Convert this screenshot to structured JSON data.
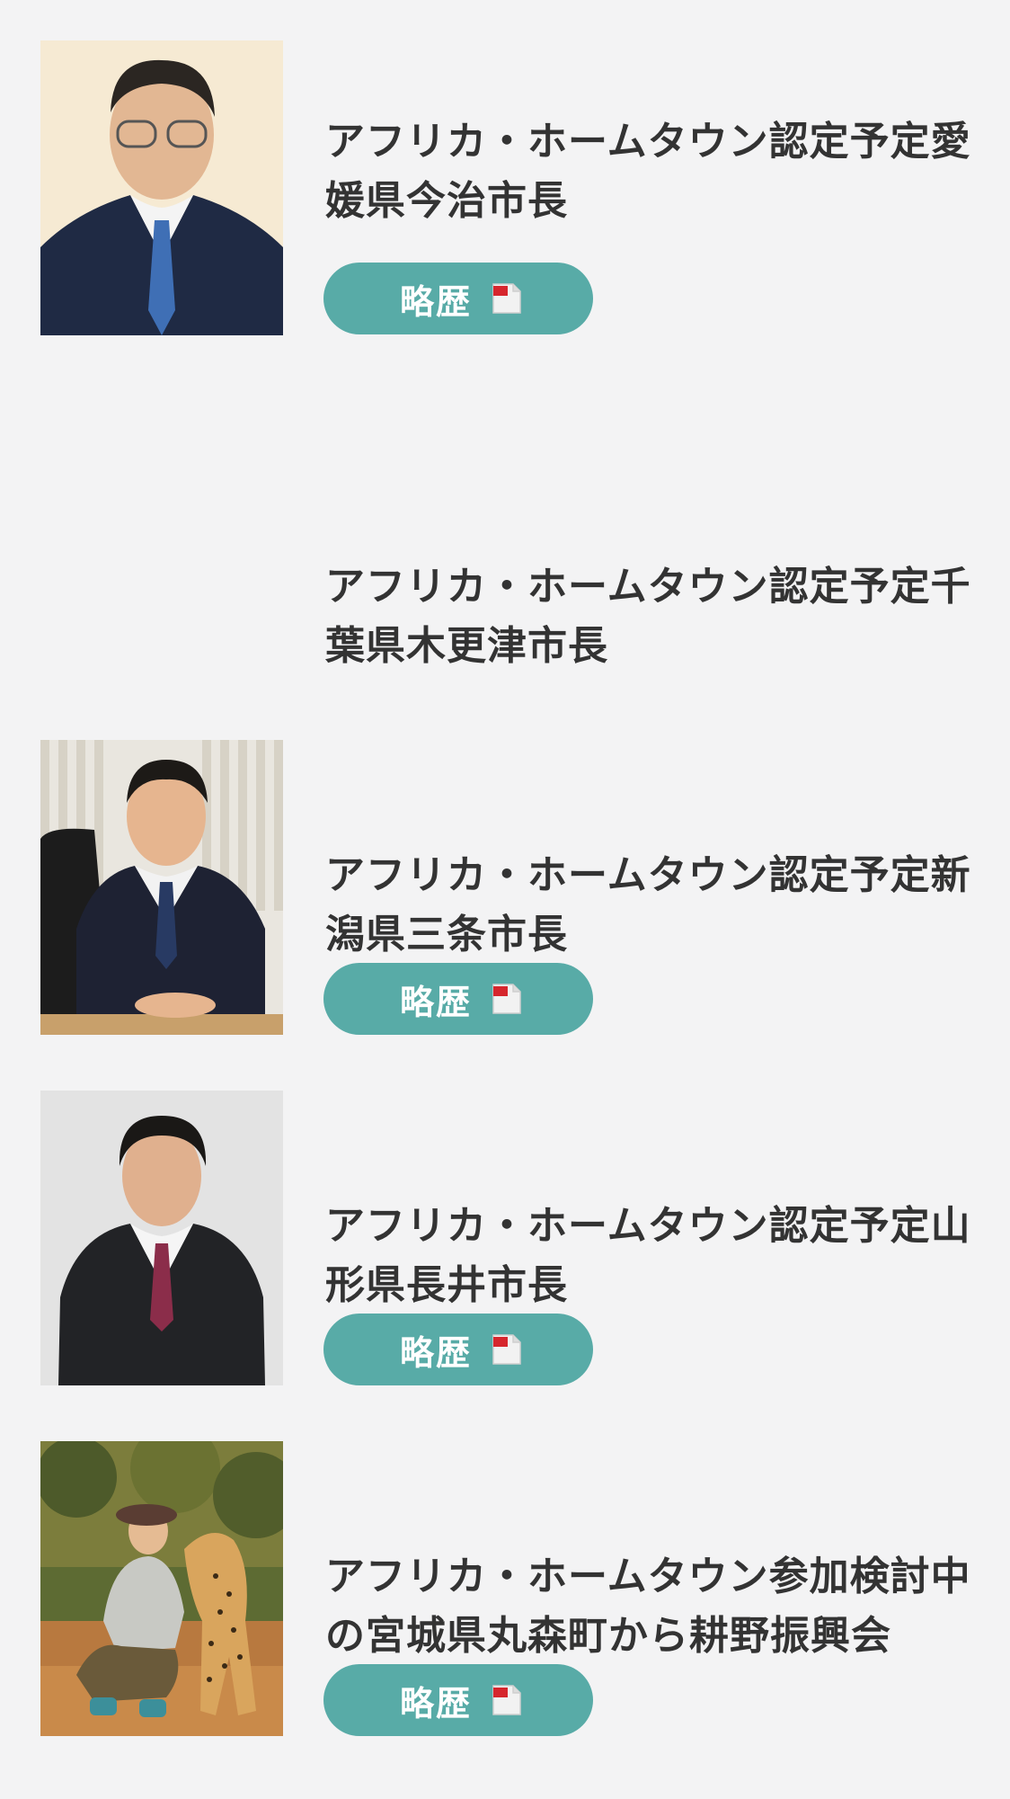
{
  "entries": [
    {
      "title": "アフリカ・ホームタウン認定予定愛媛県今治市長",
      "button_label": "略歴",
      "has_photo": true
    },
    {
      "title": "アフリカ・ホームタウン認定予定千葉県木更津市長",
      "has_photo": false
    },
    {
      "title": "アフリカ・ホームタウン認定予定新潟県三条市長",
      "button_label": "略歴",
      "has_photo": true
    },
    {
      "title": "アフリカ・ホームタウン認定予定山形県長井市長",
      "button_label": "略歴",
      "has_photo": true
    },
    {
      "title": "アフリカ・ホームタウン参加検討中の宮城県丸森町から耕野振興会",
      "button_label": "略歴",
      "has_photo": true
    }
  ],
  "colors": {
    "background": "#f3f3f4",
    "button": "#58aba7",
    "title_text": "#333333",
    "pdf_icon_red": "#d6262d"
  },
  "icons": {
    "pdf": "pdf-file-icon"
  }
}
